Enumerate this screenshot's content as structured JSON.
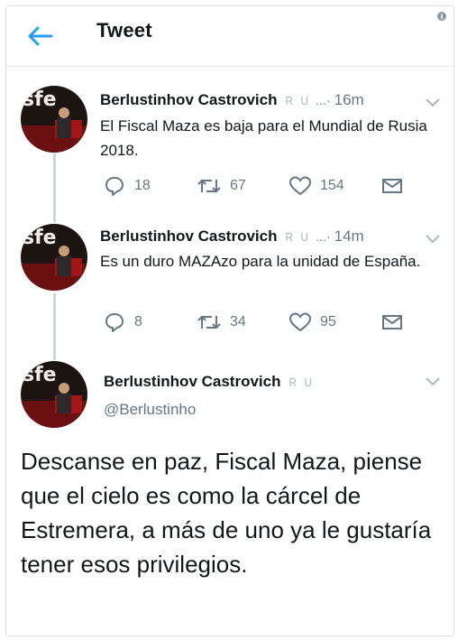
{
  "header": {
    "title": "Tweet"
  },
  "tweets": [
    {
      "name": "Berlustinhov Castrovich",
      "time": "16m",
      "text": "El Fiscal Maza es baja para el Mundial de Rusia 2018.",
      "replies": "18",
      "retweets": "67",
      "likes": "154"
    },
    {
      "name": "Berlustinhov Castrovich",
      "time": "14m",
      "text": "Es un duro MAZAzo para la unidad de España.",
      "replies": "8",
      "retweets": "34",
      "likes": "95"
    }
  ],
  "main_tweet": {
    "name": "Berlustinhov Castrovich",
    "handle": "@Berlustinho",
    "text": "Descanse en paz, Fiscal Maza, piense que el cielo es como la cárcel de Estremera, a más de uno ya le gustaría tener esos privilegios."
  },
  "badges": {
    "r": "R",
    "u": "U"
  },
  "more_dots": "...·",
  "avatar_text": "sfe",
  "colors": {
    "accent": "#1da1f2",
    "muted": "#657786",
    "line": "#cfd6db"
  },
  "icons": [
    "back-arrow-icon",
    "info-icon",
    "reply-icon",
    "retweet-icon",
    "like-icon",
    "message-icon",
    "chevron-down-icon"
  ]
}
